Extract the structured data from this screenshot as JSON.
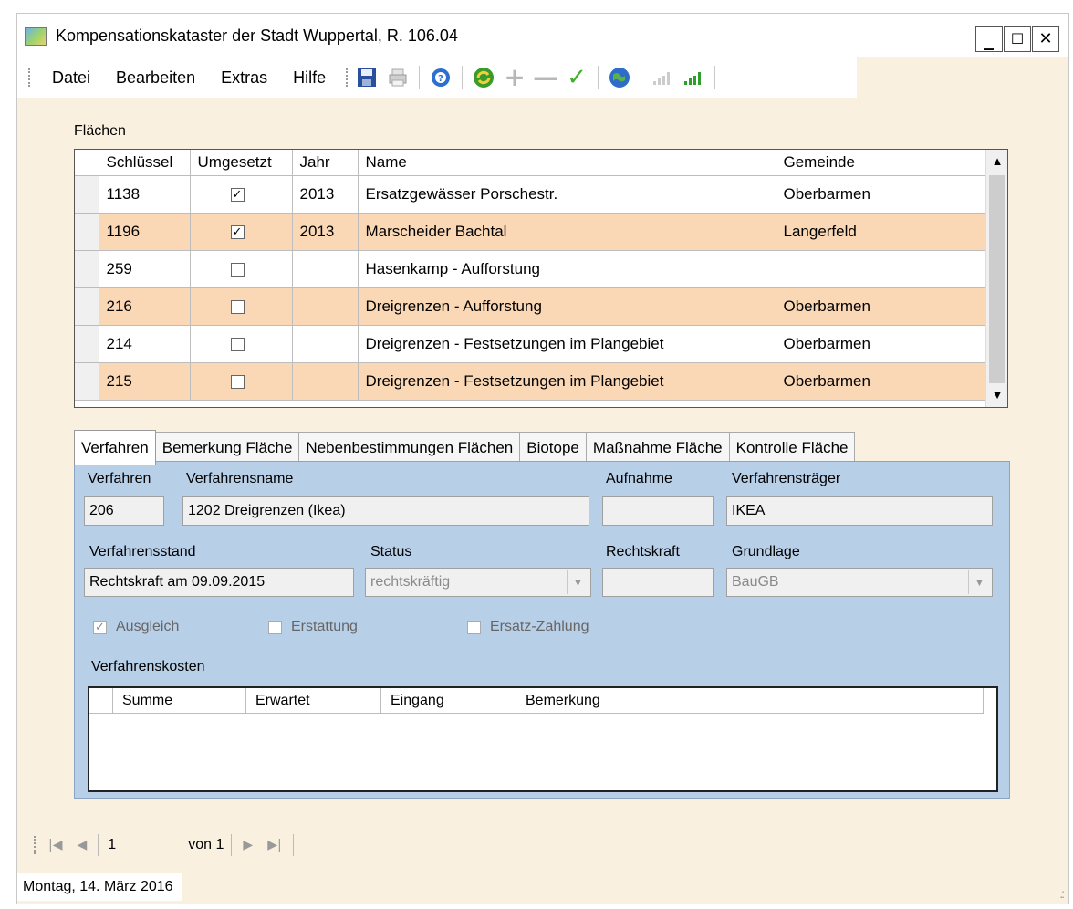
{
  "window": {
    "title": "Kompensationskataster der Stadt Wuppertal, R. 106.04",
    "controls": {
      "minimize": "_",
      "maximize": "☐",
      "close": "✕"
    }
  },
  "menu": {
    "items": [
      "Datei",
      "Bearbeiten",
      "Extras",
      "Hilfe"
    ]
  },
  "toolbar": {
    "icons": [
      "save-icon",
      "print-icon",
      "help-icon",
      "refresh-icon",
      "add-icon",
      "remove-icon",
      "confirm-icon",
      "globe-icon",
      "signal-weak-icon",
      "signal-strong-icon"
    ]
  },
  "flaechen": {
    "group_label": "Flächen",
    "columns": [
      "Schlüssel",
      "Umgesetzt",
      "Jahr",
      "Name",
      "Gemeinde"
    ],
    "rows": [
      {
        "schluessel": "1138",
        "umgesetzt": true,
        "jahr": "2013",
        "name": "Ersatzgewässer Porschestr.",
        "gemeinde": "Oberbarmen"
      },
      {
        "schluessel": "1196",
        "umgesetzt": true,
        "jahr": "2013",
        "name": "Marscheider Bachtal",
        "gemeinde": "Langerfeld"
      },
      {
        "schluessel": "259",
        "umgesetzt": false,
        "jahr": "",
        "name": "Hasenkamp - Aufforstung",
        "gemeinde": ""
      },
      {
        "schluessel": "216",
        "umgesetzt": false,
        "jahr": "",
        "name": "Dreigrenzen - Aufforstung",
        "gemeinde": "Oberbarmen"
      },
      {
        "schluessel": "214",
        "umgesetzt": false,
        "jahr": "",
        "name": "Dreigrenzen -  Festsetzungen im Plangebiet",
        "gemeinde": "Oberbarmen"
      },
      {
        "schluessel": "215",
        "umgesetzt": false,
        "jahr": "",
        "name": "Dreigrenzen  - Festsetzungen im Plangebiet",
        "gemeinde": "Oberbarmen"
      }
    ],
    "row_bg": "#fad8b6"
  },
  "tabs": [
    "Verfahren",
    "Bemerkung Fläche",
    "Nebenbestimmungen Flächen",
    "Biotope",
    "Maßnahme Fläche",
    "Kontrolle Fläche"
  ],
  "verfahren": {
    "labels": {
      "verfahren": "Verfahren",
      "verfahrensname": "Verfahrensname",
      "aufnahme": "Aufnahme",
      "verfahrenstraeger": "Verfahrensträger",
      "verfahrensstand": "Verfahrensstand",
      "status": "Status",
      "rechtskraft": "Rechtskraft",
      "grundlage": "Grundlage",
      "verfahrenskosten": "Verfahrenskosten"
    },
    "values": {
      "verfahren": "206",
      "verfahrensname": "1202  Dreigrenzen (Ikea)",
      "aufnahme": "",
      "verfahrenstraeger": "IKEA",
      "verfahrensstand": "Rechtskraft am 09.09.2015",
      "status": "rechtskräftig",
      "rechtskraft": "",
      "grundlage": "BauGB"
    },
    "checkboxes": [
      {
        "label": "Ausgleich",
        "checked": true
      },
      {
        "label": "Erstattung",
        "checked": false
      },
      {
        "label": "Ersatz-Zahlung",
        "checked": false
      }
    ],
    "kosten_columns": [
      "Summe",
      "Erwartet",
      "Eingang",
      "Bemerkung"
    ],
    "panel_bg": "#b8cfe8"
  },
  "navigator": {
    "position": "1",
    "of_label": "von 1"
  },
  "status": {
    "date": "Montag, 14. März 2016"
  },
  "colors": {
    "window_bg": "#faf0df",
    "accent_row": "#fad8b6",
    "panel": "#b8cfe8"
  }
}
